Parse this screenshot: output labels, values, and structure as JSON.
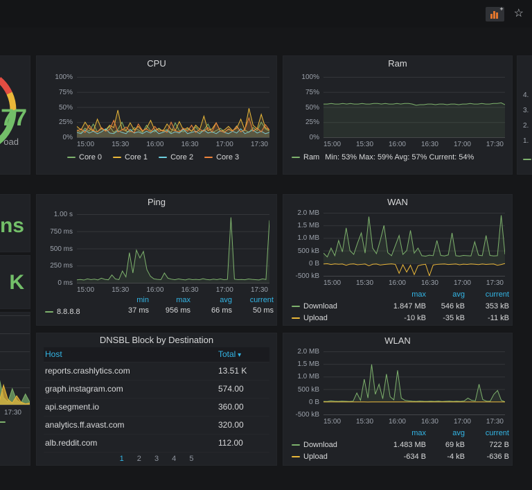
{
  "colors": {
    "green": "#7eb26d",
    "bright_green": "#73bf69",
    "yellow": "#eab839",
    "blue": "#6ed0e0",
    "orange": "#ef843c",
    "red": "#e24d42",
    "accent": "#33b5e5"
  },
  "time_ticks": [
    "15:00",
    "15:30",
    "16:00",
    "16:30",
    "17:00",
    "17:30"
  ],
  "navbar": {
    "icons": [
      {
        "name": "add-panel-icon"
      },
      {
        "name": "star-icon"
      }
    ]
  },
  "left": {
    "gauge": {
      "value": "77",
      "label": "oad"
    },
    "stat_top": "ns",
    "stat_bottom": "K",
    "mini_x_tick": "17:30"
  },
  "right_edge": {
    "y_ticks": [
      "4.",
      "3.",
      "2.",
      "1."
    ]
  },
  "cpu": {
    "title": "CPU",
    "y_ticks": [
      "100%",
      "75%",
      "50%",
      "25%",
      "0%"
    ],
    "legend": [
      {
        "label": "Core 0"
      },
      {
        "label": "Core 1"
      },
      {
        "label": "Core 2"
      },
      {
        "label": "Core 3"
      }
    ]
  },
  "ram": {
    "title": "Ram",
    "y_ticks": [
      "100%",
      "75%",
      "50%",
      "25%",
      "0%"
    ],
    "legend_label": "Ram",
    "legend_stats": "Min: 53% Max: 59% Avg: 57% Current: 54%"
  },
  "ping": {
    "title": "Ping",
    "y_ticks": [
      "1.00 s",
      "750 ms",
      "500 ms",
      "250 ms",
      "0 ms"
    ],
    "legend_label": "8.8.8.8",
    "stat_headers": [
      "min",
      "max",
      "avg",
      "current"
    ],
    "stat_values": [
      "37 ms",
      "956 ms",
      "66 ms",
      "50 ms"
    ]
  },
  "wan": {
    "title": "WAN",
    "y_ticks": [
      "2.0 MB",
      "1.5 MB",
      "1.0 MB",
      "500 kB",
      "0 B",
      "-500 kB"
    ],
    "headers": [
      "max",
      "avg",
      "current"
    ],
    "rows": [
      {
        "label": "Download",
        "values": [
          "1.847 MB",
          "546 kB",
          "353 kB"
        ]
      },
      {
        "label": "Upload",
        "values": [
          "-10 kB",
          "-35 kB",
          "-11 kB"
        ]
      }
    ]
  },
  "wlan": {
    "title": "WLAN",
    "y_ticks": [
      "2.0 MB",
      "1.5 MB",
      "1.0 MB",
      "500 kB",
      "0 B",
      "-500 kB"
    ],
    "headers": [
      "max",
      "avg",
      "current"
    ],
    "rows": [
      {
        "label": "Download",
        "values": [
          "1.483 MB",
          "69 kB",
          "722 B"
        ]
      },
      {
        "label": "Upload",
        "values": [
          "-634 B",
          "-4 kB",
          "-636 B"
        ]
      }
    ]
  },
  "dnsbl": {
    "title": "DNSBL Block by Destination",
    "col_host": "Host",
    "col_total": "Total",
    "rows": [
      {
        "host": "reports.crashlytics.com",
        "total": "13.51 K"
      },
      {
        "host": "graph.instagram.com",
        "total": "574.00"
      },
      {
        "host": "api.segment.io",
        "total": "360.00"
      },
      {
        "host": "analytics.ff.avast.com",
        "total": "320.00"
      },
      {
        "host": "alb.reddit.com",
        "total": "112.00"
      }
    ],
    "pages": [
      "1",
      "2",
      "3",
      "4",
      "5"
    ]
  },
  "chart_data": {
    "cpu": {
      "type": "line",
      "unit": "%",
      "y_min": 0,
      "y_max": 100,
      "x_ticks": [
        "15:00",
        "15:30",
        "16:00",
        "16:30",
        "17:00",
        "17:30"
      ],
      "series": [
        {
          "name": "Core 0",
          "color": "#7eb26d",
          "fill_opacity": 0.12,
          "values": [
            12,
            8,
            15,
            10,
            22,
            9,
            14,
            11,
            18,
            8,
            13,
            25,
            10,
            9,
            16,
            12,
            8,
            20,
            11,
            9,
            15,
            10,
            13,
            8,
            24,
            11,
            9,
            14,
            10,
            17,
            9,
            12,
            22,
            8,
            11,
            15,
            9,
            13,
            10,
            19,
            9,
            12,
            8,
            16,
            11,
            25,
            14,
            10
          ]
        },
        {
          "name": "Core 1",
          "color": "#eab839",
          "fill_opacity": 0.12,
          "values": [
            18,
            12,
            25,
            15,
            10,
            30,
            14,
            12,
            20,
            16,
            45,
            13,
            11,
            24,
            12,
            18,
            10,
            15,
            28,
            12,
            14,
            10,
            22,
            13,
            11,
            26,
            12,
            16,
            10,
            20,
            13,
            35,
            11,
            14,
            24,
            10,
            12,
            18,
            11,
            15,
            30,
            12,
            48,
            20,
            14,
            38,
            16,
            12
          ]
        },
        {
          "name": "Core 2",
          "color": "#6ed0e0",
          "fill_opacity": 0.12,
          "values": [
            8,
            6,
            12,
            7,
            10,
            6,
            9,
            14,
            7,
            6,
            11,
            8,
            6,
            13,
            7,
            9,
            6,
            10,
            7,
            12,
            6,
            8,
            11,
            6,
            9,
            7,
            13,
            6,
            8,
            10,
            6,
            12,
            7,
            9,
            6,
            11,
            8,
            6,
            10,
            7,
            14,
            6,
            9,
            12,
            7,
            10,
            6,
            8
          ]
        },
        {
          "name": "Core 3",
          "color": "#ef843c",
          "fill_opacity": 0.12,
          "values": [
            10,
            14,
            8,
            20,
            11,
            9,
            16,
            10,
            13,
            28,
            9,
            12,
            17,
            10,
            8,
            22,
            11,
            14,
            9,
            18,
            10,
            12,
            8,
            25,
            11,
            9,
            15,
            10,
            20,
            8,
            13,
            10,
            16,
            9,
            24,
            11,
            8,
            14,
            10,
            18,
            9,
            13,
            32,
            10,
            15,
            9,
            21,
            12
          ]
        }
      ]
    },
    "ram": {
      "type": "line",
      "unit": "%",
      "y_min": 0,
      "y_max": 100,
      "x_ticks": [
        "15:00",
        "15:30",
        "16:00",
        "16:30",
        "17:00",
        "17:30"
      ],
      "series": [
        {
          "name": "Ram",
          "color": "#7eb26d",
          "fill_opacity": 0.1,
          "values": [
            55,
            55,
            56,
            55,
            55,
            56,
            55,
            56,
            55,
            55,
            56,
            55,
            55,
            56,
            56,
            55,
            56,
            55,
            55,
            56,
            55,
            56,
            56,
            55,
            53,
            54,
            54,
            55,
            55,
            54,
            55,
            55,
            54,
            55,
            55,
            54,
            55,
            55,
            56,
            55,
            55,
            56,
            55,
            55,
            56,
            56,
            57,
            54
          ]
        }
      ]
    },
    "ping": {
      "type": "line",
      "unit": "ms",
      "y_min": 0,
      "y_max": 1050,
      "x_ticks": [
        "15:00",
        "15:30",
        "16:00",
        "16:30",
        "17:00",
        "17:30"
      ],
      "series": [
        {
          "name": "8.8.8.8",
          "color": "#7eb26d",
          "fill_opacity": 0.1,
          "values": [
            45,
            50,
            42,
            60,
            48,
            55,
            44,
            70,
            52,
            46,
            120,
            58,
            48,
            180,
            90,
            460,
            150,
            500,
            380,
            480,
            200,
            100,
            60,
            52,
            48,
            150,
            70,
            55,
            46,
            60,
            50,
            44,
            58,
            48,
            52,
            46,
            62,
            50,
            45,
            55,
            48,
            60,
            46,
            52,
            1000,
            55,
            48,
            50,
            46,
            58,
            52,
            48,
            44,
            60,
            50,
            956
          ]
        }
      ]
    },
    "wan": {
      "type": "line",
      "unit": "kB",
      "y_min": -500,
      "y_max": 2000,
      "x_ticks": [
        "15:00",
        "15:30",
        "16:00",
        "16:30",
        "17:00",
        "17:30"
      ],
      "series": [
        {
          "name": "Download",
          "color": "#7eb26d",
          "fill_opacity": 0.1,
          "values": [
            400,
            250,
            600,
            300,
            900,
            450,
            1400,
            500,
            350,
            800,
            1200,
            400,
            1847,
            600,
            380,
            900,
            1500,
            420,
            300,
            700,
            1100,
            350,
            500,
            1300,
            400,
            600,
            300,
            280,
            320,
            300,
            900,
            310,
            290,
            330,
            1200,
            300,
            280,
            310,
            300,
            290,
            850,
            320,
            300,
            1100,
            310,
            290,
            300,
            1900,
            353
          ]
        },
        {
          "name": "Upload",
          "color": "#eab839",
          "fill_opacity": 0,
          "values": [
            -30,
            -20,
            -50,
            -25,
            -40,
            -30,
            -80,
            -35,
            -25,
            -60,
            -45,
            -30,
            -100,
            -40,
            -30,
            -70,
            -50,
            -35,
            -25,
            -45,
            -400,
            -60,
            -350,
            -80,
            -450,
            -100,
            -60,
            -40,
            -500,
            -70,
            -45,
            -35,
            -30,
            -50,
            -40,
            -30,
            -60,
            -35,
            -45,
            -30,
            -40,
            -55,
            -30,
            -45,
            -35,
            -30,
            -80,
            -50,
            -11
          ]
        }
      ]
    },
    "wlan": {
      "type": "line",
      "unit": "kB",
      "y_min": -500,
      "y_max": 2000,
      "x_ticks": [
        "15:00",
        "15:30",
        "16:00",
        "16:30",
        "17:00",
        "17:30"
      ],
      "series": [
        {
          "name": "Download",
          "color": "#7eb26d",
          "fill_opacity": 0.1,
          "values": [
            20,
            15,
            40,
            25,
            18,
            30,
            22,
            16,
            28,
            350,
            60,
            900,
            150,
            1483,
            300,
            700,
            120,
            1100,
            200,
            80,
            1250,
            150,
            60,
            40,
            25,
            20,
            30,
            22,
            18,
            25,
            20,
            28,
            16,
            22,
            30,
            18,
            25,
            20,
            35,
            150,
            60,
            40,
            700,
            90,
            30,
            25,
            300,
            450,
            60,
            1
          ]
        },
        {
          "name": "Upload",
          "color": "#eab839",
          "fill_opacity": 0,
          "values": [
            -1,
            -0.5,
            -1,
            -0.6,
            -0.8,
            -1,
            -0.5,
            -0.7,
            -2,
            -1.5,
            -3,
            -1,
            -4,
            -2,
            -1,
            -3,
            -1.5,
            -0.8,
            -2.5,
            -1,
            -0.6,
            -1.5,
            -0.7,
            -0.5,
            -0.6,
            -0.4,
            -0.5,
            -0.6,
            -0.5,
            -0.4,
            -0.6,
            -0.5,
            -0.4,
            -0.5,
            -0.6,
            -0.4,
            -0.5,
            -0.6,
            -0.5,
            -1,
            -0.6,
            -0.5,
            -1.5,
            -0.7,
            -0.5,
            -0.6,
            -1,
            -1.2,
            -0.6,
            -0.64
          ]
        }
      ]
    },
    "mini": {
      "type": "line",
      "unit": "",
      "y_min": 0,
      "y_max": 100,
      "x_ticks": [
        "17:30"
      ],
      "series": [
        {
          "name": "series-green",
          "color": "#7eb26d",
          "fill_opacity": 0.7,
          "values": [
            0,
            0,
            1,
            0,
            2,
            1,
            0,
            3,
            1,
            26,
            4,
            2,
            30,
            8,
            3,
            18,
            5,
            2,
            12,
            3
          ]
        },
        {
          "name": "series-yellow",
          "color": "#eab839",
          "fill_opacity": 0.7,
          "values": [
            0,
            1,
            0,
            2,
            1,
            3,
            1,
            2,
            14,
            6,
            20,
            5,
            3,
            22,
            6,
            2,
            10,
            3,
            1,
            2
          ]
        }
      ]
    }
  }
}
